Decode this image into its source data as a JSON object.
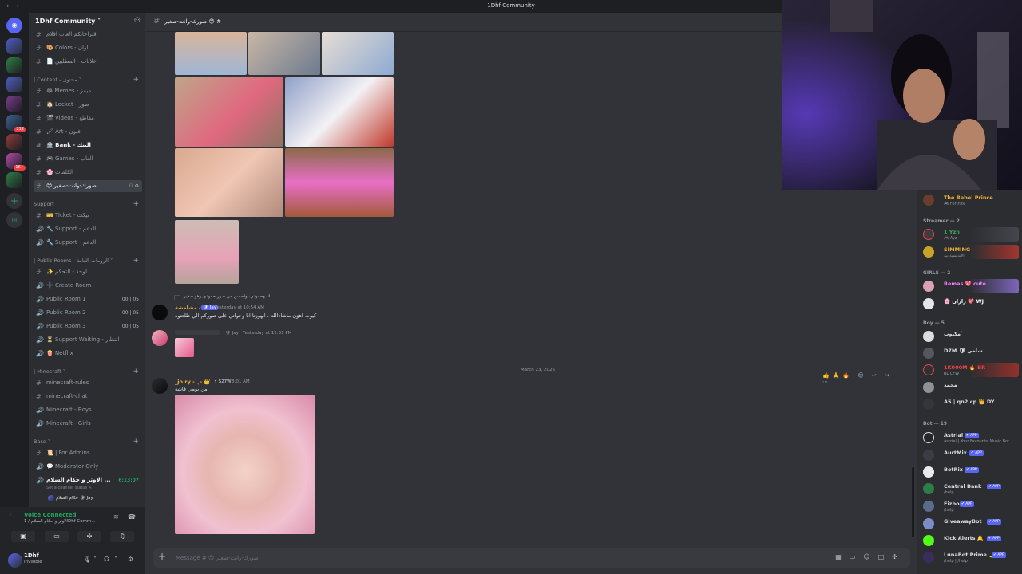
{
  "window": {
    "title": "1Dhf Community",
    "nav": "← →"
  },
  "server": {
    "name": "1Dhf Community ˅"
  },
  "guild_badges": {
    "b1": "212",
    "b2": "1K+"
  },
  "channels": [
    {
      "icon": "#",
      "label": "اقتراحاتكم العاب اقلام",
      "sel": false
    },
    {
      "icon": "#",
      "label": "🎨 Colors - الوان",
      "sel": false
    },
    {
      "icon": "#",
      "label": "📄 اعلانات - المطلبين",
      "sel": false
    }
  ],
  "categories": {
    "content": "| Content - محتوى ˅",
    "support": "Support ˅",
    "public_rooms": "| Public Rooms - الرومات العامة ˅",
    "minecraft": "| Minecraft ˅",
    "base": "Base ˅"
  },
  "content_channels": [
    {
      "icon": "#",
      "label": "😂 Memes - ميمز"
    },
    {
      "icon": "#",
      "label": "🏠 Locket - صور"
    },
    {
      "icon": "#",
      "label": "🎬 Videos - مقاطع"
    },
    {
      "icon": "#",
      "label": "🖌 Art - فنون"
    },
    {
      "icon": "#",
      "label": "🏦 Bank - البنك"
    },
    {
      "icon": "#",
      "label": "🎮 Games - العاب"
    },
    {
      "icon": "#",
      "label": "🌸 الكلمات"
    },
    {
      "icon": "#",
      "label": "😊 صورك-وانت-صغير"
    }
  ],
  "support_channels": [
    {
      "icon": "#",
      "label": "🎫 Ticket - تيكت"
    },
    {
      "icon": "🔊",
      "label": "🔧 Support - الدعم"
    },
    {
      "icon": "🔊",
      "label": "🔧 Support - الدعم"
    }
  ],
  "public_channels": [
    {
      "icon": "#",
      "label": "✨ لوحة - التحكم",
      "tail": ""
    },
    {
      "icon": "🔊",
      "label": "➕ Create Room",
      "tail": ""
    },
    {
      "icon": "🔊",
      "label": "Public Room 1",
      "tail": "00 | 05"
    },
    {
      "icon": "🔊",
      "label": "Public Room 2",
      "tail": "00 | 05"
    },
    {
      "icon": "🔊",
      "label": "Public Room 3",
      "tail": "00 | 05"
    },
    {
      "icon": "🔊",
      "label": "⏳ Support Waiting - انتظار",
      "tail": ""
    },
    {
      "icon": "🔊",
      "label": "🍿 Netflix",
      "tail": ""
    }
  ],
  "minecraft_channels": [
    {
      "icon": "#",
      "label": "minecraft-rules"
    },
    {
      "icon": "#",
      "label": "minecraft-chat"
    },
    {
      "icon": "🔊",
      "label": "Minecraft - Boys"
    },
    {
      "icon": "🔊",
      "label": "Minecraft - Girls"
    }
  ],
  "base_channels": [
    {
      "icon": "#",
      "label": "📜 | For Admins",
      "tail": ""
    },
    {
      "icon": "🔊",
      "label": "💬 Moderator Only",
      "tail": ""
    },
    {
      "icon": "🔊",
      "label": "الاوتر و حكام السلام ...",
      "tail": "6:13:07"
    }
  ],
  "base_sub": {
    "status": "Set a channel status ✎",
    "member": "حكام السلام 🛡 Jay"
  },
  "voice": {
    "status": "Voice Connected",
    "sub": "الاوتر و حكام السلام / 1Dhf Comm..."
  },
  "user": {
    "name": "1Dhf",
    "status": "Invisible"
  },
  "chat": {
    "channel": "صورك-وانت-صغير 😊 #",
    "reply_text": "انا وحمودي، ولحسن من صور حمودي وهو صغير",
    "m1_user": "بنت مشامشة",
    "m1_tag": "🛡 Jay",
    "m1_time": "Yesterday at 10:54 AM",
    "m1_text": "كيوت اهوَن ماشاءالله ، انهوزتا انا وخواتي على صوركم الي طلعتوه",
    "m2_tag": "🛡 Jay",
    "m2_time": "Yesterday at 12:31 PM",
    "date_divider": "March 23, 2026",
    "m3_user": "_jo.ry -`ˎ- 👑",
    "m3_badge": "⚡ S27W",
    "m3_time": "8:01 AM",
    "m3_text": "من يومي قاشه",
    "reactions": "👍🙏🔥 ☺ ↩ ↪ ⋯",
    "placeholder": "Message # 😊 صورك-وانت-صغير"
  },
  "members": {
    "top": {
      "name": "The Rebel Prince",
      "sub": "🎮 Fortnite",
      "color": "#f0b232"
    },
    "streamer_cat": "Streamer — 2",
    "streamers": [
      {
        "name": "1 Yzn",
        "sub": "🎮 Ayz",
        "color": "#3ba55c",
        "banner": "#4a4a52"
      },
      {
        "name": "SIMMING",
        "sub": "الاندلسية بيه",
        "color": "#f0b232",
        "banner": "#b6382f"
      }
    ],
    "girls_cat": "GIRLS — 2",
    "girls": [
      {
        "name": "Remas 💖 cute",
        "sub": "",
        "color": "#f47fff",
        "banner": "#8b6fd1"
      },
      {
        "name": "🌸 رازان 💖 WJ",
        "sub": "",
        "color": "#f2f3f5",
        "banner": ""
      }
    ],
    "boy_cat": "Boy — 5",
    "boys": [
      {
        "name": "مكيوب ً",
        "sub": "",
        "color": "#949ba4",
        "banner": ""
      },
      {
        "name": "D7M 🛡 شامي",
        "sub": "",
        "color": "#949ba4",
        "banner": ""
      },
      {
        "name": "1K000M 🔥 BR",
        "sub": "BL CFW",
        "color": "#ed4245",
        "banner": "#a4322a"
      },
      {
        "name": "محمد",
        "sub": "",
        "color": "#949ba4",
        "banner": ""
      },
      {
        "name": "A5 | qn2.cp 👑 DY",
        "sub": "",
        "color": "#949ba4",
        "banner": ""
      }
    ],
    "bot_cat": "Bot — 19",
    "bots": [
      {
        "name": "Astrial",
        "sub": "Astrial | Your Favourite Music Bot"
      },
      {
        "name": "AurtMix",
        "sub": ""
      },
      {
        "name": "BotRix",
        "sub": ""
      },
      {
        "name": "Central Bank",
        "sub": "/help"
      },
      {
        "name": "Fizbo",
        "sub": "/help"
      },
      {
        "name": "GiveawayBot",
        "sub": ""
      },
      {
        "name": "Kick Alerts 🔔",
        "sub": ""
      },
      {
        "name": "LunaBot Prime 🌙",
        "sub": "/help | /help"
      }
    ],
    "app_badge": "✔ APP"
  }
}
